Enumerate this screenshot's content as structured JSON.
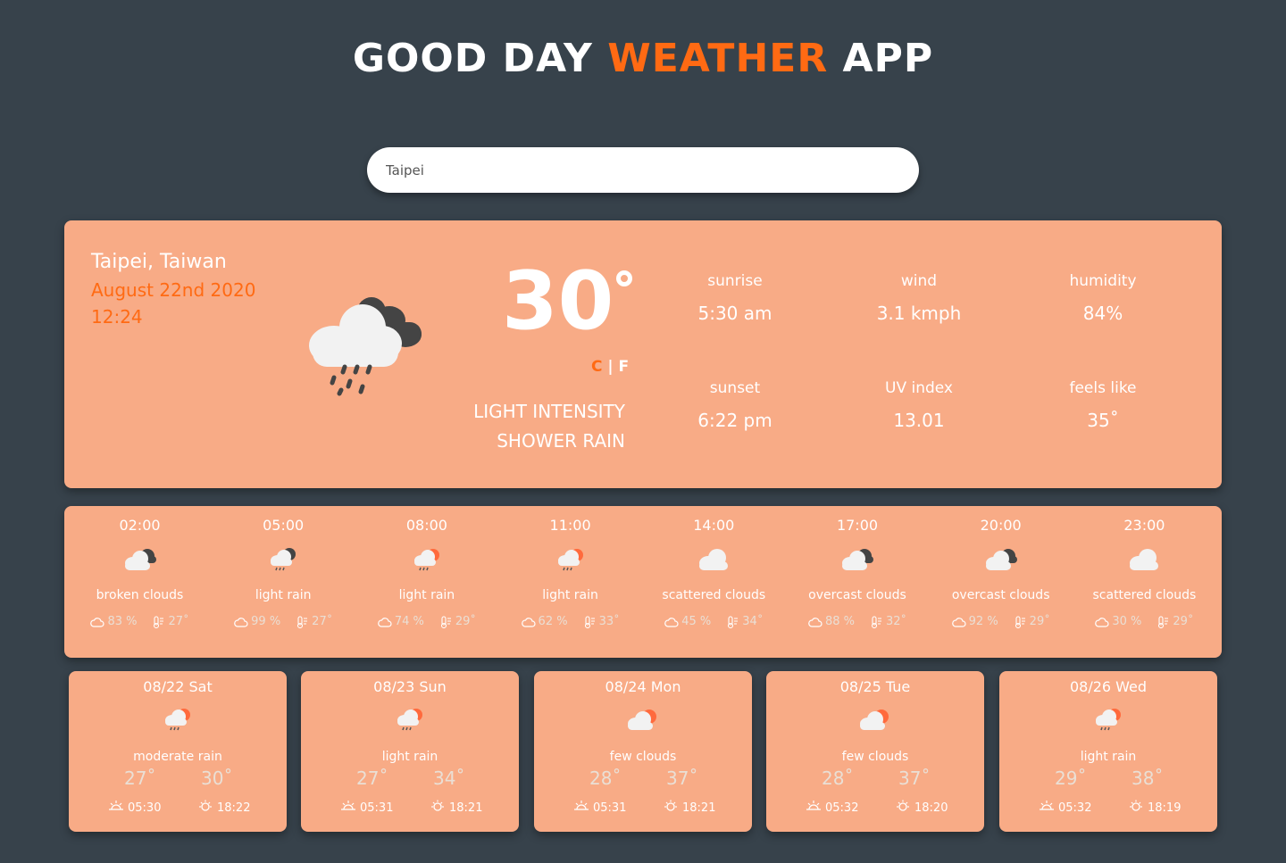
{
  "header": {
    "title_part1": "GOOD DAY",
    "title_accent": "WEATHER",
    "title_part3": "APP"
  },
  "search": {
    "value": "Taipei"
  },
  "current": {
    "city": "Taipei, Taiwan",
    "date": "August 22nd 2020",
    "time": "12:24",
    "temperature": "30",
    "unit_c": "C",
    "unit_sep": "|",
    "unit_f": "F",
    "description": "light intensity shower rain",
    "icon": "rain-cloud-icon",
    "stats": {
      "sunrise_label": "sunrise",
      "sunrise_value": "5:30 am",
      "wind_label": "wind",
      "wind_value": "3.1 kmph",
      "humidity_label": "humidity",
      "humidity_value": "84%",
      "sunset_label": "sunset",
      "sunset_value": "6:22 pm",
      "uv_label": "UV index",
      "uv_value": "13.01",
      "feels_label": "feels like",
      "feels_value": "35˚"
    }
  },
  "hourly": [
    {
      "time": "02:00",
      "desc": "broken clouds",
      "cloud": "83 %",
      "temp": "27˚",
      "icon": "night-cloud-icon"
    },
    {
      "time": "05:00",
      "desc": "light rain",
      "cloud": "99 %",
      "temp": "27˚",
      "icon": "night-rain-icon"
    },
    {
      "time": "08:00",
      "desc": "light rain",
      "cloud": "74 %",
      "temp": "29˚",
      "icon": "sun-rain-icon"
    },
    {
      "time": "11:00",
      "desc": "light rain",
      "cloud": "62 %",
      "temp": "33˚",
      "icon": "sun-rain-icon"
    },
    {
      "time": "14:00",
      "desc": "scattered clouds",
      "cloud": "45 %",
      "temp": "34˚",
      "icon": "cloud-icon"
    },
    {
      "time": "17:00",
      "desc": "overcast clouds",
      "cloud": "88 %",
      "temp": "32˚",
      "icon": "night-cloud-icon"
    },
    {
      "time": "20:00",
      "desc": "overcast clouds",
      "cloud": "92 %",
      "temp": "29˚",
      "icon": "night-cloud-icon"
    },
    {
      "time": "23:00",
      "desc": "scattered clouds",
      "cloud": "30 %",
      "temp": "29˚",
      "icon": "cloud-icon"
    }
  ],
  "daily": [
    {
      "date": "08/22 Sat",
      "desc": "moderate rain",
      "min": "27˚",
      "max": "30˚",
      "sunrise": "05:30",
      "sunset": "18:22",
      "icon": "sun-rain-icon"
    },
    {
      "date": "08/23 Sun",
      "desc": "light rain",
      "min": "27˚",
      "max": "34˚",
      "sunrise": "05:31",
      "sunset": "18:21",
      "icon": "sun-rain-icon"
    },
    {
      "date": "08/24 Mon",
      "desc": "few clouds",
      "min": "28˚",
      "max": "37˚",
      "sunrise": "05:31",
      "sunset": "18:21",
      "icon": "sun-cloud-icon"
    },
    {
      "date": "08/25 Tue",
      "desc": "few clouds",
      "min": "28˚",
      "max": "37˚",
      "sunrise": "05:32",
      "sunset": "18:20",
      "icon": "sun-cloud-icon"
    },
    {
      "date": "08/26 Wed",
      "desc": "light rain",
      "min": "29˚",
      "max": "38˚",
      "sunrise": "05:32",
      "sunset": "18:19",
      "icon": "sun-rain-icon"
    }
  ],
  "colors": {
    "background": "#37424b",
    "card": "#f8ab86",
    "accent": "#ff6a13",
    "muted": "#eadfd5"
  }
}
